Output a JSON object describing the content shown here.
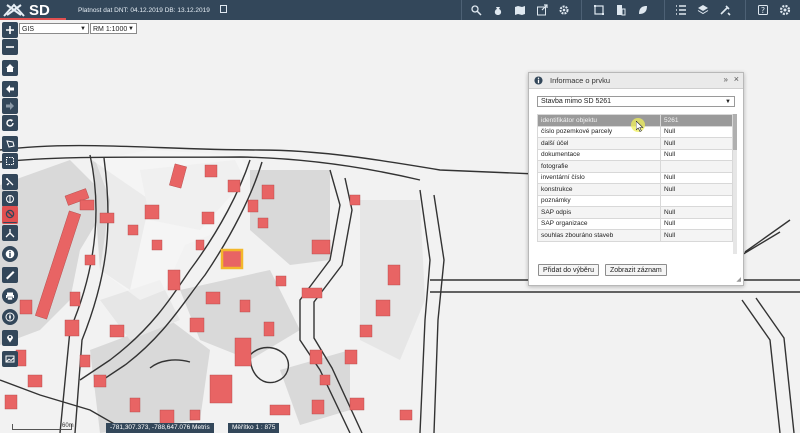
{
  "header": {
    "logo_text": "SD",
    "status": "Platnost dat DNT: 04.12.2019 DB: 13.12.2019",
    "tool_icons": [
      "person-search-icon",
      "money-bag-icon",
      "map-icon",
      "export-icon",
      "gear-icon",
      "frame-icon",
      "building-icon",
      "leaf-icon",
      "list-icon",
      "layers-icon",
      "tools-icon",
      "help-icon",
      "settings-icon"
    ]
  },
  "map": {
    "layer_select": "GIS",
    "scale_select": "RM 1:1000",
    "scale_label": "60m",
    "coordinates": "-781,307.373, -788,647.076  Metris",
    "scale_display": "Měřítko 1 : 875",
    "colors": {
      "building": "#e86464",
      "selected": "#f3b72b",
      "zone": "#d8d8d8",
      "road": "#333333"
    }
  },
  "lefttools": [
    {
      "icon": "zoom-in-icon",
      "active": false
    },
    {
      "icon": "zoom-out-icon",
      "active": false
    },
    {
      "icon": "home-icon",
      "active": false
    },
    {
      "icon": "back-icon",
      "active": false
    },
    {
      "icon": "forward-icon",
      "active": false
    },
    {
      "icon": "refresh-icon",
      "active": false
    },
    {
      "icon": "select-icon",
      "active": false
    },
    {
      "icon": "box-select-icon",
      "active": false
    },
    {
      "icon": "measure-icon",
      "active": false
    },
    {
      "icon": "clear-icon",
      "active": false
    },
    {
      "icon": "shield-icon",
      "active": false
    },
    {
      "icon": "no-entry-icon",
      "active": true
    },
    {
      "icon": "split-icon",
      "active": false
    },
    {
      "icon": "info-icon",
      "active": false
    },
    {
      "icon": "ruler-icon",
      "active": false
    },
    {
      "icon": "print-icon",
      "active": false
    },
    {
      "icon": "compass-icon",
      "active": false
    },
    {
      "icon": "location-icon",
      "active": false
    },
    {
      "icon": "gallery-icon",
      "active": false
    }
  ],
  "panel": {
    "title": "Informace o prvku",
    "feature": "Stavba mimo SD 5261",
    "rows": [
      {
        "name": "identifikátor objektu",
        "value": "5261"
      },
      {
        "name": "číslo pozemkové parcely",
        "value": "Null"
      },
      {
        "name": "další účel",
        "value": "Null"
      },
      {
        "name": "dokumentace",
        "value": "Null"
      },
      {
        "name": "fotografie",
        "value": ""
      },
      {
        "name": "inventární číslo",
        "value": "Null"
      },
      {
        "name": "konstrukce",
        "value": "Null"
      },
      {
        "name": "poznámky",
        "value": ""
      },
      {
        "name": "SAP odpis",
        "value": "Null"
      },
      {
        "name": "SAP organizace",
        "value": "Null"
      },
      {
        "name": "souhlas zbouráno staveb",
        "value": "Null"
      }
    ],
    "add_button": "Přidat do výběru",
    "show_button": "Zobrazit záznam"
  }
}
